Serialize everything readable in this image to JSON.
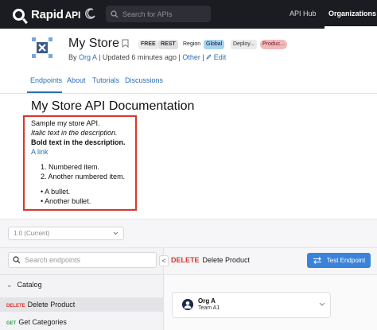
{
  "topbar": {
    "brand": "Rapid",
    "brand_suffix": "API",
    "search_placeholder": "Search for APIs",
    "nav_hub": "API Hub",
    "nav_org": "Organizations",
    "icons": [
      "moon-icon",
      "search-icon"
    ]
  },
  "api": {
    "title": "My Store",
    "badges": {
      "free": "FREE",
      "rest": "REST",
      "region_label": "Region",
      "region_value": "Global",
      "deploy": "Deploy...",
      "product": "Produc..."
    },
    "byline": {
      "by": "By",
      "org": "Org A",
      "updated": "| Updated 6 minutes ago |",
      "other": "Other",
      "sep": "|",
      "edit": "Edit"
    }
  },
  "tabs": [
    "Endpoints",
    "About",
    "Tutorials",
    "Discussions"
  ],
  "doc": {
    "title": "My Store API Documentation",
    "line1": "Sample my store API.",
    "italic": "Italic text in the description.",
    "bold": "Bold text in the description.",
    "link": "A link",
    "numbered": [
      "1. Numbered item.",
      "2. Another numbered item."
    ],
    "bullets": [
      "• A bullet.",
      "• Another bullet."
    ]
  },
  "endpoints": {
    "version": "1.0 (Current)",
    "search_placeholder": "Search endpoints",
    "collapse_glyph": "<",
    "group": "Catalog",
    "items": [
      {
        "method": "DELETE",
        "name": "Delete Product"
      },
      {
        "method": "GET",
        "name": "Get Categories"
      }
    ]
  },
  "detail": {
    "method": "DELETE",
    "name": "Delete Product",
    "test_button": "Test Endpoint",
    "org_name": "Org A",
    "team": "Team A1"
  },
  "colors": {
    "topbar": "#1b1c22",
    "link": "#2c6fb5",
    "delete": "#d9362b",
    "get": "#2b9f4a",
    "primary_button": "#3a83d8",
    "highlight_box": "#d9362b"
  }
}
